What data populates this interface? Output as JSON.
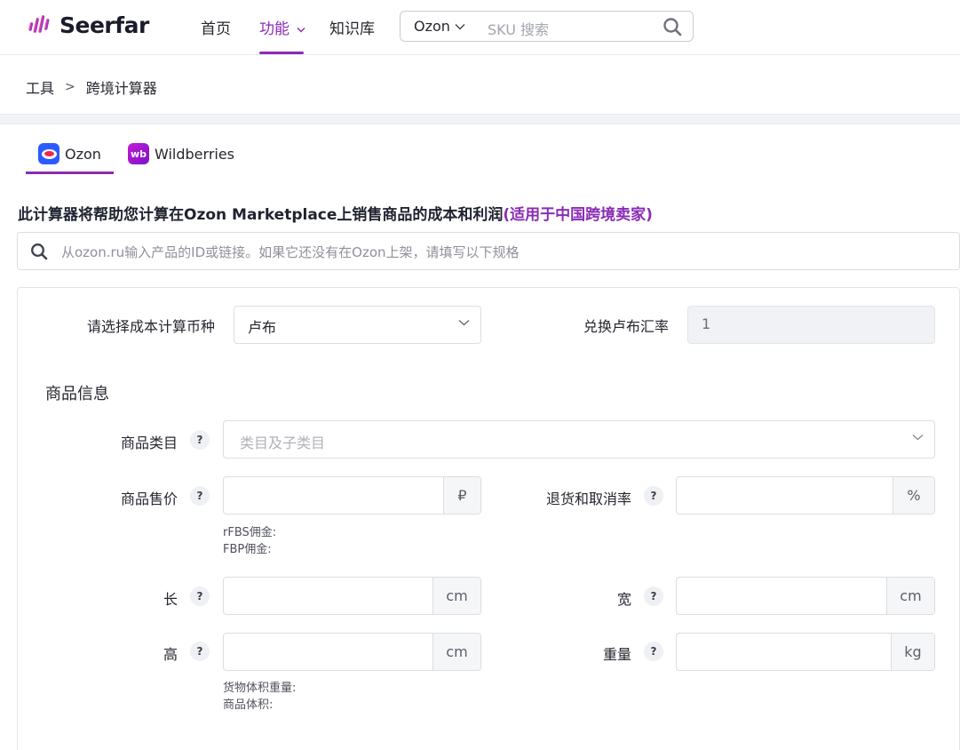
{
  "header": {
    "logo_text": "Seerfar",
    "nav": [
      {
        "label": "首页"
      },
      {
        "label": "功能"
      },
      {
        "label": "知识库"
      }
    ],
    "search": {
      "platform": "Ozon",
      "placeholder": "SKU 搜索"
    }
  },
  "breadcrumb": {
    "items": [
      "工具",
      "跨境计算器"
    ],
    "separator": ">"
  },
  "platform_tabs": [
    {
      "label": "Ozon",
      "active": true
    },
    {
      "label": "Wildberries",
      "active": false
    }
  ],
  "headline": {
    "main": "此计算器将帮助您计算在Ozon Marketplace上销售商品的成本和利润",
    "accent": "(适用于中国跨境卖家)"
  },
  "product_search": {
    "placeholder": "从ozon.ru输入产品的ID或链接。如果它还没有在Ozon上架，请填写以下规格"
  },
  "form": {
    "currency_label": "请选择成本计算币种",
    "currency_value": "卢布",
    "rate_label": "兑换卢布汇率",
    "rate_value": "1",
    "section_title": "商品信息",
    "category_label": "商品类目",
    "category_placeholder": "类目及子类目",
    "price_label": "商品售价",
    "price_unit": "₽",
    "return_label": "退货和取消率",
    "return_unit": "%",
    "commission_hint_1": "rFBS佣金:",
    "commission_hint_2": "FBP佣金:",
    "length_label": "长",
    "length_unit": "cm",
    "width_label": "宽",
    "width_unit": "cm",
    "height_label": "高",
    "height_unit": "cm",
    "weight_label": "重量",
    "weight_unit": "kg",
    "volume_hint_1": "货物体积重量:",
    "volume_hint_2": "商品体积:",
    "help_glyph": "?"
  },
  "colors": {
    "accent": "#8a2bb4",
    "ozon_blue": "#2b5bff",
    "wb_purple": "#a21ad0"
  }
}
